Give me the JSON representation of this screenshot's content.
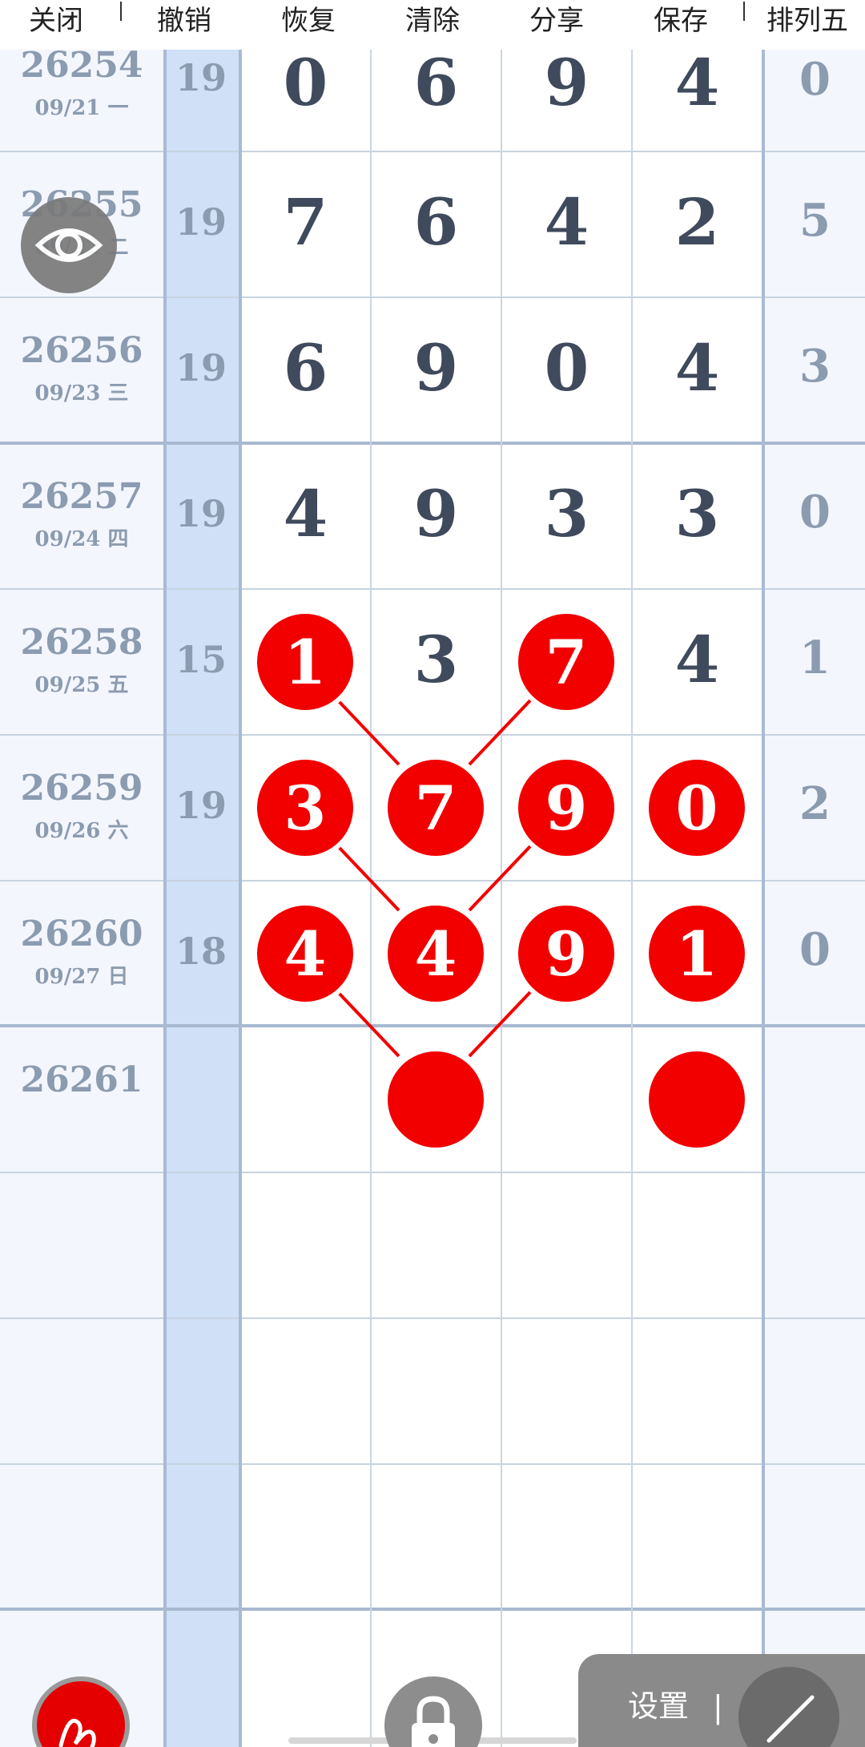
{
  "toolbar": {
    "close": "关闭",
    "undo": "撤销",
    "redo": "恢复",
    "clear": "清除",
    "share": "分享",
    "save": "保存",
    "lottery": "排列五"
  },
  "rows": [
    {
      "issue": "26254",
      "date": "09/21 一",
      "sum": "19",
      "d": [
        "0",
        "6",
        "9",
        "4"
      ],
      "p5": "0"
    },
    {
      "issue": "26255",
      "date": "09/22 二",
      "sum": "19",
      "d": [
        "7",
        "6",
        "4",
        "2"
      ],
      "p5": "5"
    },
    {
      "issue": "26256",
      "date": "09/23 三",
      "sum": "19",
      "d": [
        "6",
        "9",
        "0",
        "4"
      ],
      "p5": "3"
    },
    {
      "issue": "26257",
      "date": "09/24 四",
      "sum": "19",
      "d": [
        "4",
        "9",
        "3",
        "3"
      ],
      "p5": "0"
    },
    {
      "issue": "26258",
      "date": "09/25 五",
      "sum": "15",
      "d": [
        "1",
        "3",
        "7",
        "4"
      ],
      "p5": "1"
    },
    {
      "issue": "26259",
      "date": "09/26 六",
      "sum": "19",
      "d": [
        "3",
        "7",
        "9",
        "0"
      ],
      "p5": "2"
    },
    {
      "issue": "26260",
      "date": "09/27 日",
      "sum": "18",
      "d": [
        "4",
        "4",
        "9",
        "1"
      ],
      "p5": "0"
    },
    {
      "issue": "26261",
      "date": "",
      "sum": "",
      "d": [
        "",
        "",
        "",
        ""
      ],
      "p5": ""
    }
  ],
  "marked": [
    {
      "row": 4,
      "col": 0
    },
    {
      "row": 4,
      "col": 2
    },
    {
      "row": 5,
      "col": 0
    },
    {
      "row": 5,
      "col": 1
    },
    {
      "row": 5,
      "col": 2
    },
    {
      "row": 5,
      "col": 3
    },
    {
      "row": 6,
      "col": 0
    },
    {
      "row": 6,
      "col": 1
    },
    {
      "row": 6,
      "col": 2
    },
    {
      "row": 6,
      "col": 3
    },
    {
      "row": 7,
      "col": 1
    },
    {
      "row": 7,
      "col": 3
    }
  ],
  "links": [
    [
      [
        4,
        0
      ],
      [
        5,
        1
      ]
    ],
    [
      [
        4,
        2
      ],
      [
        5,
        1
      ]
    ],
    [
      [
        5,
        0
      ],
      [
        6,
        1
      ]
    ],
    [
      [
        5,
        2
      ],
      [
        6,
        1
      ]
    ],
    [
      [
        6,
        0
      ],
      [
        7,
        1
      ]
    ],
    [
      [
        6,
        2
      ],
      [
        7,
        1
      ]
    ]
  ],
  "bottom": {
    "settings_label": "设置",
    "separator": "|"
  },
  "colors": {
    "ball": "#f20000",
    "sum_column": "#cfe0f7",
    "side_column": "#f3f6fc",
    "digit_text": "#3f4a5c",
    "muted_text": "#8b9bb0"
  }
}
